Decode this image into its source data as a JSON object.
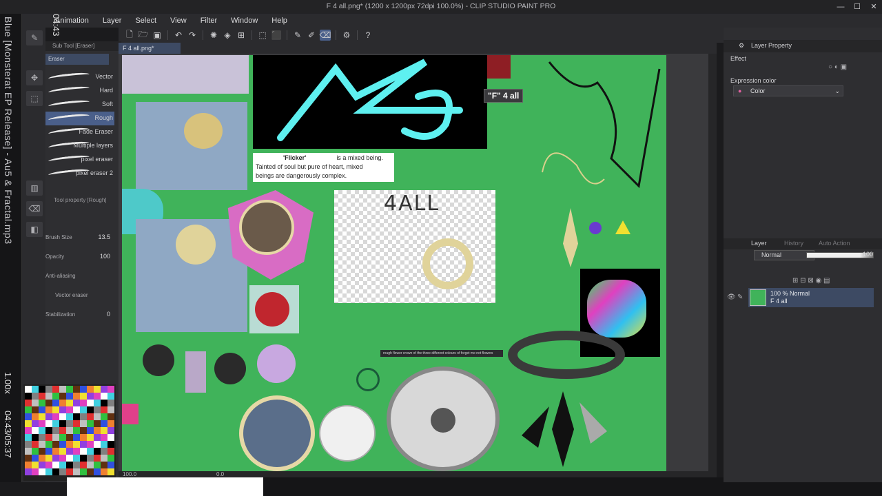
{
  "window": {
    "title": "F 4 all.png* (1200 x 1200px 72dpi 100.0%) - CLIP STUDIO PAINT PRO",
    "controls": [
      "—",
      "☐",
      "✕"
    ]
  },
  "menu": [
    "Animation",
    "Layer",
    "Select",
    "View",
    "Filter",
    "Window",
    "Help"
  ],
  "overlay": {
    "vertical_title": "Blue [Monsterat EP Release] - Au5 & Fractal.mp3",
    "time_top": "04:43",
    "time_bottom": "04:43/05:37",
    "zoom_side": "1.00x"
  },
  "subtool": {
    "header": "Sub Tool [Eraser]",
    "tab": "Eraser",
    "brushes": [
      "Vector",
      "Hard",
      "Soft",
      "Rough",
      "Fade Eraser",
      "Multiple layers",
      "pixel eraser",
      "pixel eraser 2"
    ],
    "selected_brush": "Rough",
    "tool_property_header": "Tool property [Rough]",
    "brush_size_label": "Brush Size",
    "brush_size": "13.5",
    "opacity_label": "Opacity",
    "opacity": "100",
    "antialias_label": "Anti-aliasing",
    "vector_eraser_label": "Vector eraser",
    "stabilization_label": "Stabilization",
    "stabilization": "0"
  },
  "document": {
    "tab": "F 4 all.png*",
    "tooltip": "\"F\" 4 all",
    "text_box": {
      "name": "'Flicker'",
      "line1": "is a mixed being.",
      "line2": "Tainted of soul but pure of heart, mixed",
      "line3": "beings are dangerously complex."
    },
    "banner": "rough flower crown of the three different colours of forget me not flowers",
    "scribble": "4ALL",
    "status_zoom": "100.0",
    "status_angle": "0.0"
  },
  "right_panel": {
    "layer_property_tab": "Layer Property",
    "effect_label": "Effect",
    "expression_color_label": "Expression color",
    "expression_color_value": "Color",
    "layer_tab": "Layer",
    "history_tab": "History",
    "auto_action_tab": "Auto Action",
    "blend_mode": "Normal",
    "opacity": "100",
    "layer_line1": "100 % Normal",
    "layer_line2": "F 4 all"
  },
  "colors": {
    "canvas_green": "#40b35a",
    "selection_blue": "#4a5f8a",
    "cyan_stroke": "#5ef0f0"
  }
}
